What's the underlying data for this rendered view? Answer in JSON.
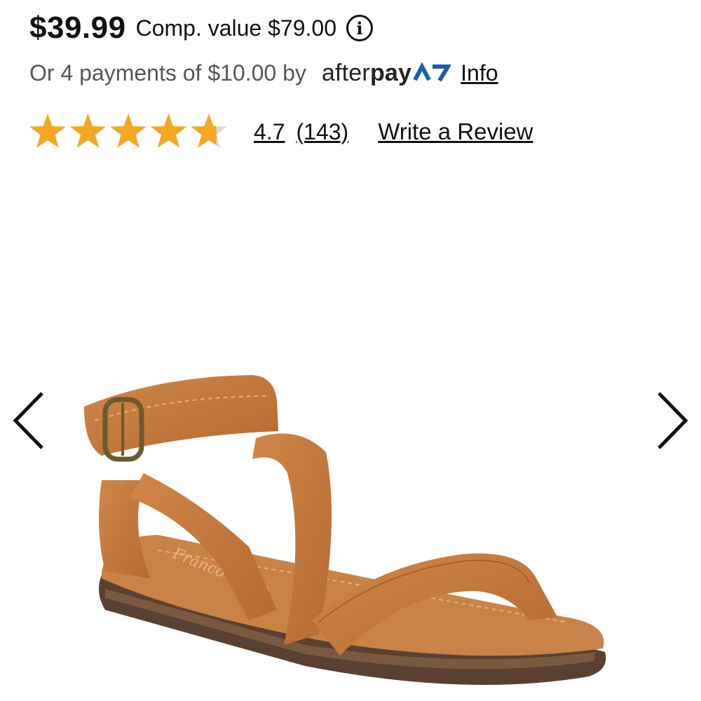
{
  "price": {
    "current": "$39.99",
    "comp_value": "Comp. value $79.00",
    "info_icon": "i"
  },
  "afterpay": {
    "text": "Or 4 payments of $10.00 by",
    "brand_light": "after",
    "brand_bold": "pay",
    "brand_color": "#222222",
    "logo_accent": "#1a5fa8",
    "info_link": "Info"
  },
  "rating": {
    "value": 4.7,
    "max": 5,
    "value_text": "4.7",
    "count_text": "(143)",
    "write_review": "Write a Review",
    "star_color": "#f5a623",
    "empty_color": "#d9d9d9"
  },
  "carousel": {
    "prev_icon": "chevron-left-icon",
    "next_icon": "chevron-right-icon"
  },
  "product": {
    "image_alt": "Tan leather ankle-strap sandal with buckle",
    "insole_brand": "Franco Sarto",
    "leather_color": "#c57a3e"
  }
}
